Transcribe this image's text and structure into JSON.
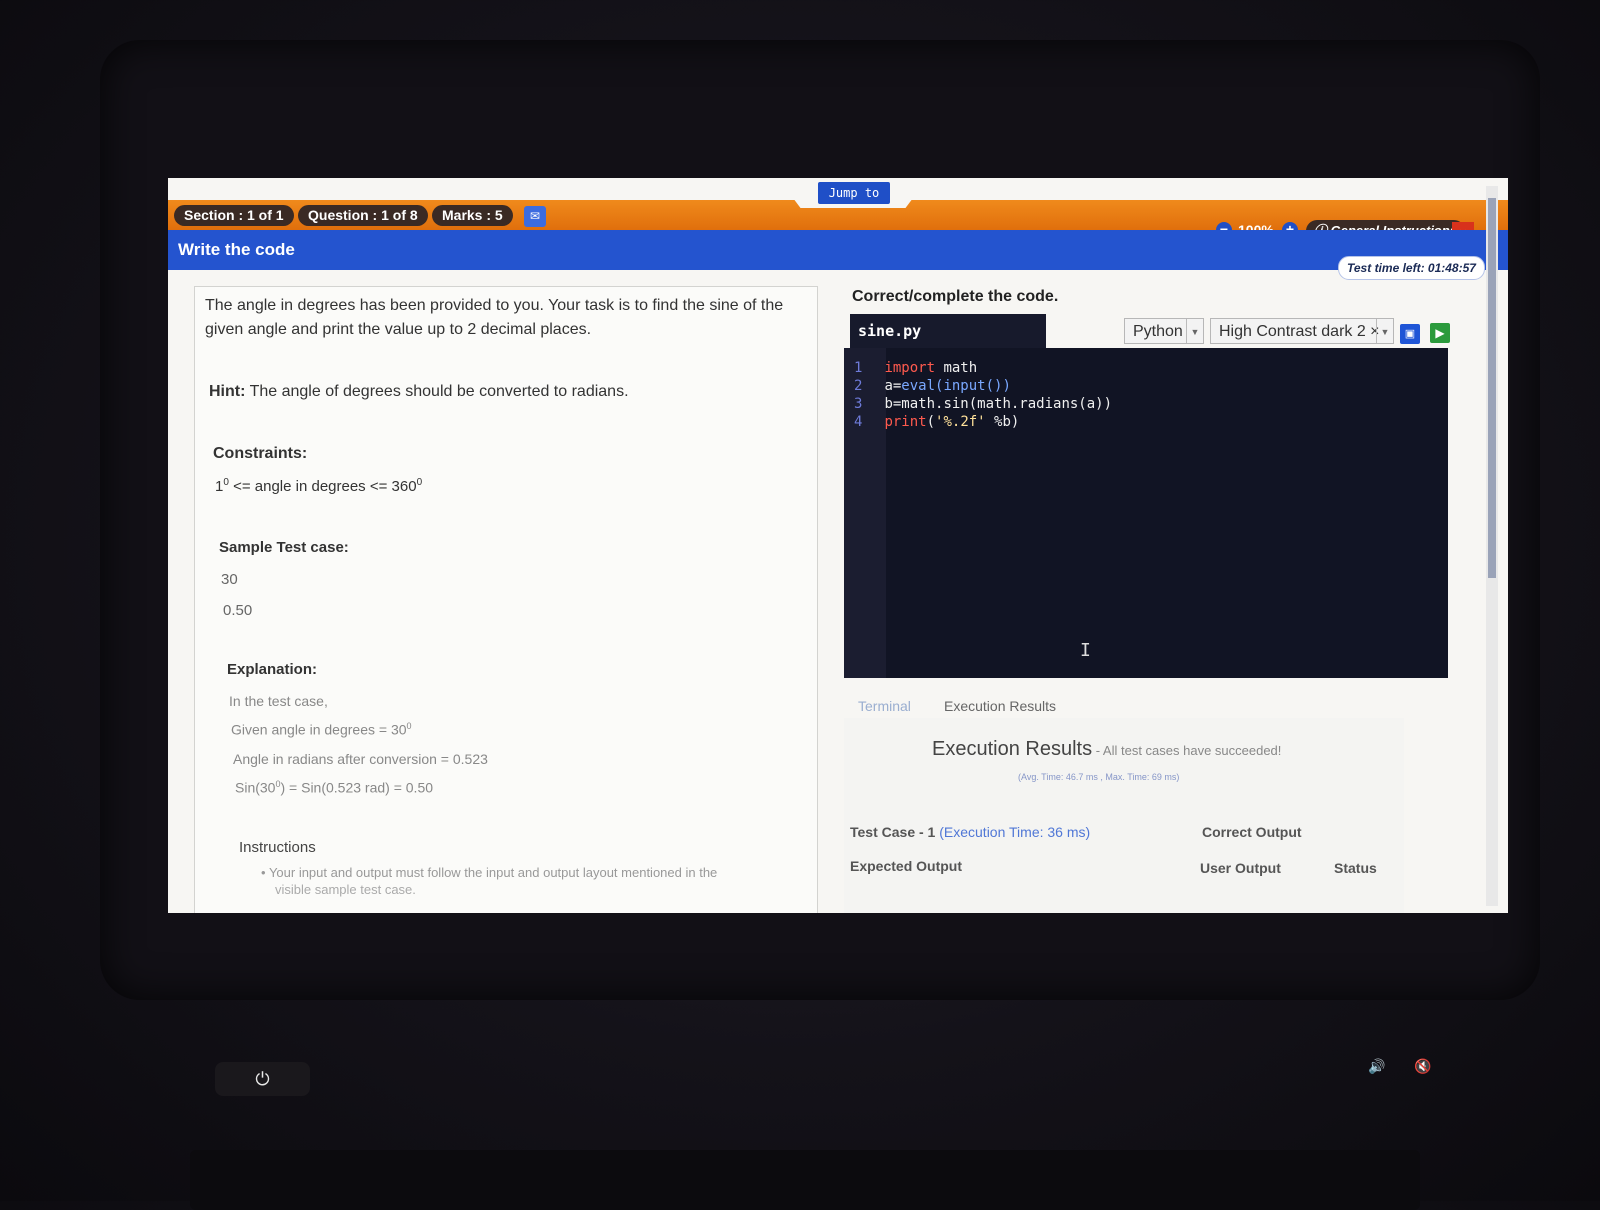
{
  "header": {
    "jump_label": "Jump to",
    "section": "Section : 1 of 1",
    "question": "Question : 1 of 8",
    "marks": "Marks : 5",
    "zoom": "100%",
    "general_instructions": "General Instructions",
    "close_label": "×",
    "title": "Write the code",
    "timer": "Test time left: 01:48:57"
  },
  "problem": {
    "statement_line1": "The angle in degrees has been provided to you. Your task is to find the sine of the",
    "statement_line2": "given angle and print the value up to 2 decimal places.",
    "hint_label": "Hint:",
    "hint_text": "The angle of degrees should be converted to radians.",
    "constraints_label": "Constraints:",
    "constraint_pre": "1",
    "constraint_sup1": "0",
    "constraint_mid": " <= angle in degrees <= 360",
    "constraint_sup2": "0",
    "sample_label": "Sample Test case:",
    "sample_input": "30",
    "sample_output": "0.50",
    "explanation_label": "Explanation:",
    "exp_line1": "In the test case,",
    "exp_line2": "Given angle in degrees = 30",
    "exp_line3": "Angle in radians after conversion = 0.523",
    "exp_line4": "Sin(30",
    "exp_line4b": ") = Sin(0.523 rad) = 0.50",
    "deg_sup": "0",
    "instructions_label": "Instructions",
    "instruction_1": "Your input and output must follow the input and output layout mentioned in the",
    "instruction_1b": "visible sample test case."
  },
  "editor": {
    "heading": "Correct/complete the code.",
    "filename": "sine.py",
    "language": "Python",
    "theme": "High Contrast dark 2",
    "lines": [
      {
        "n": "1",
        "parts": [
          "import",
          " math"
        ]
      },
      {
        "n": "2",
        "parts": [
          "a=",
          "eval(input())"
        ]
      },
      {
        "n": "3",
        "parts": [
          "b=math.sin(math.radians(a))"
        ]
      },
      {
        "n": "4",
        "parts": [
          "print",
          "(",
          "'%.2f'",
          " %b)"
        ]
      }
    ]
  },
  "results": {
    "tab_terminal": "Terminal",
    "tab_execution": "Execution Results",
    "title": "Execution Results",
    "subtitle": " - All test cases have succeeded!",
    "stats": "(Avg. Time: 46.7 ms , Max. Time: 69 ms)",
    "test_case": "Test Case - 1",
    "exec_time": "(Execution Time: 36 ms)",
    "correct_output": "Correct Output",
    "expected_output": "Expected Output",
    "user_output": "User Output",
    "status": "Status"
  }
}
